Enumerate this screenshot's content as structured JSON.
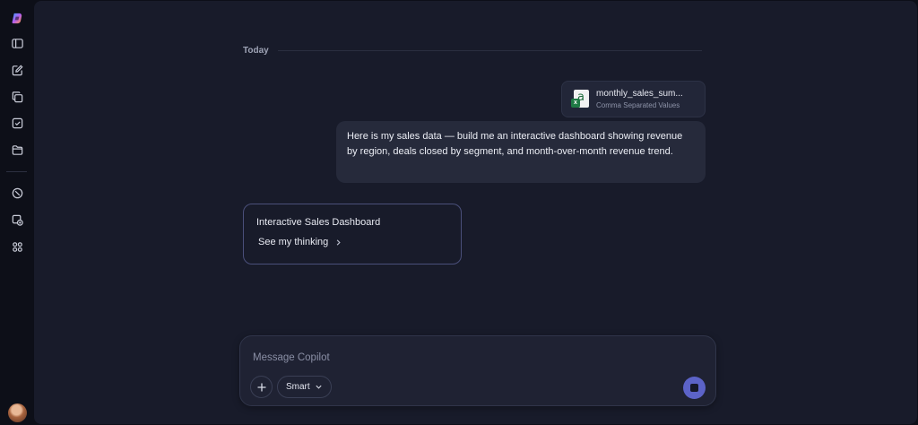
{
  "sidebar": {
    "items": [
      {
        "icon": "copilot-logo-icon"
      },
      {
        "icon": "sidebar-toggle-icon"
      },
      {
        "icon": "new-chat-icon"
      },
      {
        "icon": "pages-icon"
      },
      {
        "icon": "tasks-icon"
      },
      {
        "icon": "folder-icon"
      },
      {
        "icon": "discover-icon"
      },
      {
        "icon": "image-create-icon"
      },
      {
        "icon": "apps-icon"
      }
    ],
    "avatar": "user-avatar"
  },
  "conversation": {
    "date_label": "Today",
    "attachment": {
      "name": "monthly_sales_sum...",
      "type": "Comma Separated Values",
      "badge": "x"
    },
    "user_message": "Here is my sales data — build me an interactive dashboard showing revenue by region, deals closed by segment, and month-over-month revenue trend.",
    "response_card": {
      "title": "Interactive Sales Dashboard",
      "link_label": "See my thinking"
    }
  },
  "composer": {
    "placeholder": "Message Copilot",
    "value": "",
    "mode_label": "Smart"
  },
  "colors": {
    "background": "#0d0f18",
    "panel": "#181b2a",
    "bubble": "#262a3b",
    "accent": "#5c63c8",
    "card_border": "#4a4f7a"
  }
}
